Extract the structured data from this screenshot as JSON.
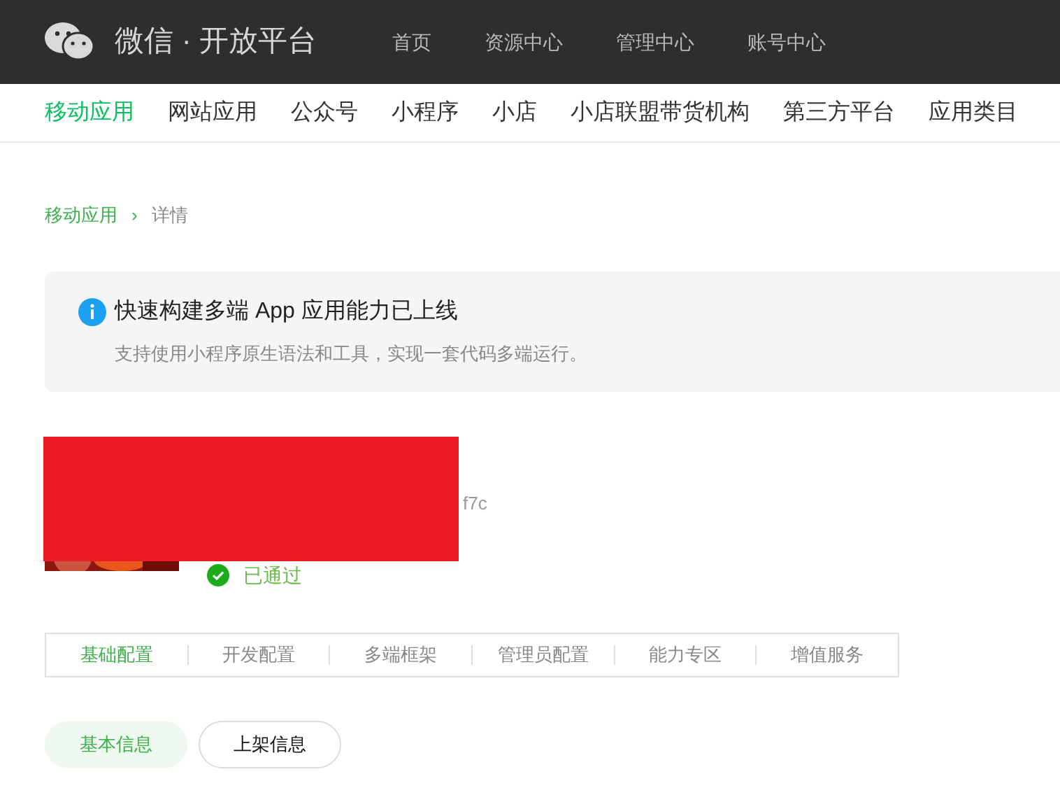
{
  "header": {
    "logo_text": "微信 · 开放平台",
    "nav": [
      {
        "label": "首页"
      },
      {
        "label": "资源中心"
      },
      {
        "label": "管理中心"
      },
      {
        "label": "账号中心"
      }
    ]
  },
  "category_nav": [
    {
      "label": "移动应用",
      "selected": true
    },
    {
      "label": "网站应用",
      "selected": false
    },
    {
      "label": "公众号",
      "selected": false
    },
    {
      "label": "小程序",
      "selected": false
    },
    {
      "label": "小店",
      "selected": false
    },
    {
      "label": "小店联盟带货机构",
      "selected": false
    },
    {
      "label": "第三方平台",
      "selected": false
    },
    {
      "label": "应用类目",
      "selected": false
    }
  ],
  "breadcrumb": {
    "parent": "移动应用",
    "separator": "›",
    "current": "详情"
  },
  "notice": {
    "title": "快速构建多端 App 应用能力已上线",
    "text": "支持使用小程序原生语法和工具，实现一套代码多端运行。"
  },
  "app": {
    "id_fragment": "f7c",
    "status": "已通过",
    "approved": true,
    "redacted": true
  },
  "config_tabs": [
    {
      "label": "基础配置",
      "selected": true
    },
    {
      "label": "开发配置",
      "selected": false
    },
    {
      "label": "多端框架",
      "selected": false
    },
    {
      "label": "管理员配置",
      "selected": false
    },
    {
      "label": "能力专区",
      "selected": false
    },
    {
      "label": "增值服务",
      "selected": false
    }
  ],
  "info_tabs": [
    {
      "label": "基本信息",
      "selected": true
    },
    {
      "label": "上架信息",
      "selected": false
    }
  ]
}
